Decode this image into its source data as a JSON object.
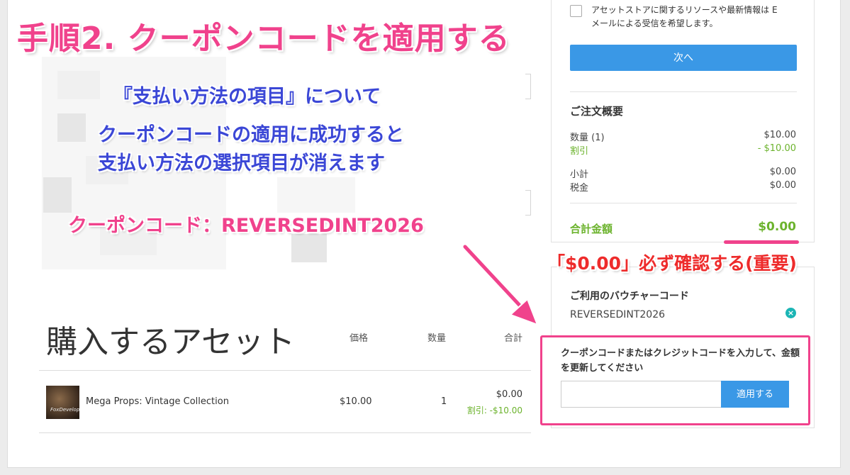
{
  "annotations": {
    "title": "手順2. クーポンコードを適用する",
    "note_heading": "『支払い方法の項目』について",
    "note_line1": "クーポンコードの適用に成功すると",
    "note_line2": "支払い方法の選択項目が消えます",
    "coupon_label": "クーポンコード：REVERSEDINT2026",
    "confirm_label": "「$0.00」必ず確認する(重要)"
  },
  "assets": {
    "title": "購入するアセット",
    "columns": [
      "価格",
      "数量",
      "合計"
    ],
    "items": [
      {
        "thumbnail_text": "FoxDeveloper",
        "name": "Mega Props: Vintage Collection",
        "price": "$10.00",
        "quantity": "1",
        "total": "$0.00",
        "discount": "割引: -$10.00"
      }
    ]
  },
  "newsletter": {
    "label_line1": "アセットストアに関するリソースや最新情報は E",
    "label_line2": "メールによる受信を希望します。"
  },
  "next_button": "次へ",
  "summary": {
    "title": "ご注文概要",
    "quantity_label": "数量 (1)",
    "quantity_value": "$10.00",
    "discount_label": "割引",
    "discount_value": "- $10.00",
    "subtotal_label": "小計",
    "subtotal_value": "$0.00",
    "tax_label": "税金",
    "tax_value": "$0.00",
    "total_label": "合計金額",
    "total_value": "$0.00"
  },
  "voucher": {
    "title": "ご利用のバウチャーコード",
    "code": "REVERSEDINT2026",
    "remove_icon": "×"
  },
  "coupon": {
    "hint": "クーポンコードまたはクレジットコードを入力して、金額を更新してください",
    "input_value": "",
    "apply_label": "適用する"
  },
  "colors": {
    "accent_blue": "#3a98e6",
    "discount_green": "#6cb32d",
    "annotation_pink": "#f0428c",
    "annotation_blue": "#3b47d6",
    "annotation_red": "#ee2b2b"
  }
}
